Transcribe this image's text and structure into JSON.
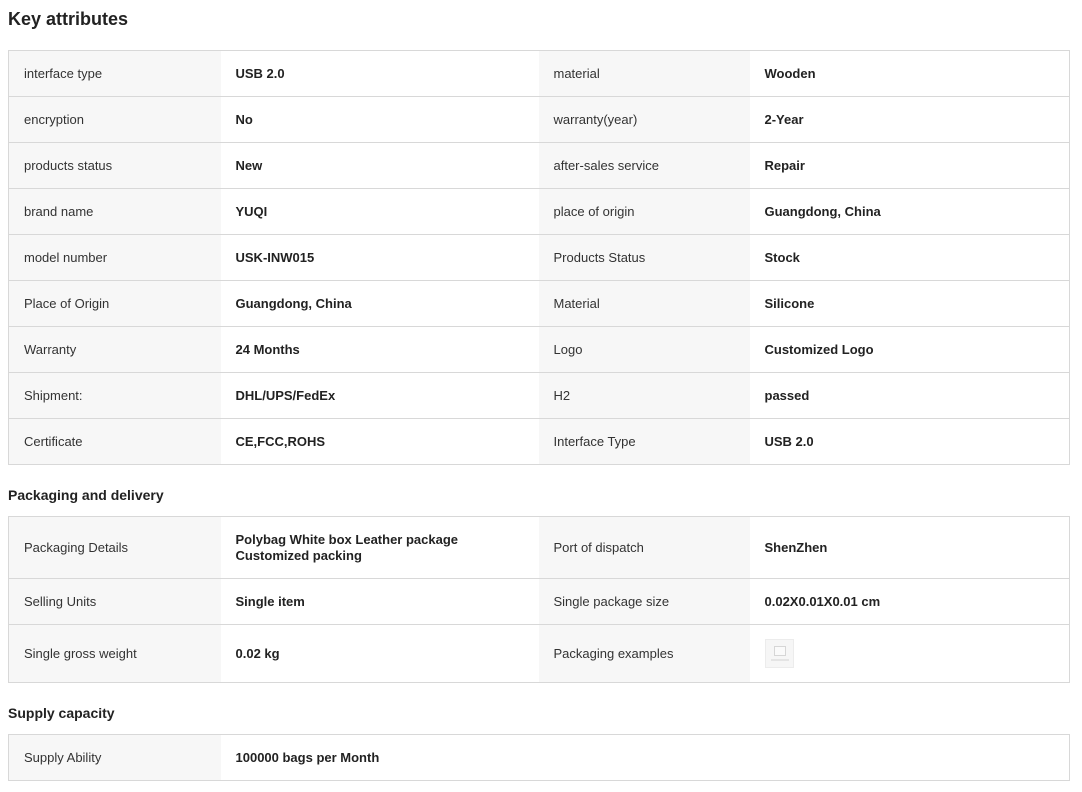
{
  "key_attributes": {
    "title": "Key attributes",
    "rows": [
      [
        {
          "label": "interface type",
          "value": "USB 2.0"
        },
        {
          "label": "material",
          "value": "Wooden"
        }
      ],
      [
        {
          "label": "encryption",
          "value": "No"
        },
        {
          "label": "warranty(year)",
          "value": "2-Year"
        }
      ],
      [
        {
          "label": "products status",
          "value": "New"
        },
        {
          "label": "after-sales service",
          "value": "Repair"
        }
      ],
      [
        {
          "label": "brand name",
          "value": "YUQI"
        },
        {
          "label": "place of origin",
          "value": "Guangdong, China"
        }
      ],
      [
        {
          "label": "model number",
          "value": "USK-INW015"
        },
        {
          "label": "Products Status",
          "value": "Stock"
        }
      ],
      [
        {
          "label": "Place of Origin",
          "value": "Guangdong, China"
        },
        {
          "label": "Material",
          "value": "Silicone"
        }
      ],
      [
        {
          "label": "Warranty",
          "value": "24 Months"
        },
        {
          "label": "Logo",
          "value": "Customized Logo"
        }
      ],
      [
        {
          "label": "Shipment:",
          "value": "DHL/UPS/FedEx"
        },
        {
          "label": "H2",
          "value": "passed"
        }
      ],
      [
        {
          "label": "Certificate",
          "value": "CE,FCC,ROHS"
        },
        {
          "label": "Interface Type",
          "value": "USB 2.0"
        }
      ]
    ]
  },
  "packaging": {
    "title": "Packaging and delivery",
    "rows": [
      [
        {
          "label": "Packaging Details",
          "value": "Polybag White box Leather package Customized packing"
        },
        {
          "label": "Port of dispatch",
          "value": "ShenZhen"
        }
      ],
      [
        {
          "label": "Selling Units",
          "value": "Single item"
        },
        {
          "label": "Single package size",
          "value": "0.02X0.01X0.01 cm"
        }
      ],
      [
        {
          "label": "Single gross weight",
          "value": "0.02 kg"
        },
        {
          "label": "Packaging examples",
          "value": ""
        }
      ]
    ]
  },
  "supply": {
    "title": "Supply capacity",
    "rows": [
      [
        {
          "label": "Supply Ability",
          "value": "100000 bags per Month"
        }
      ]
    ]
  }
}
